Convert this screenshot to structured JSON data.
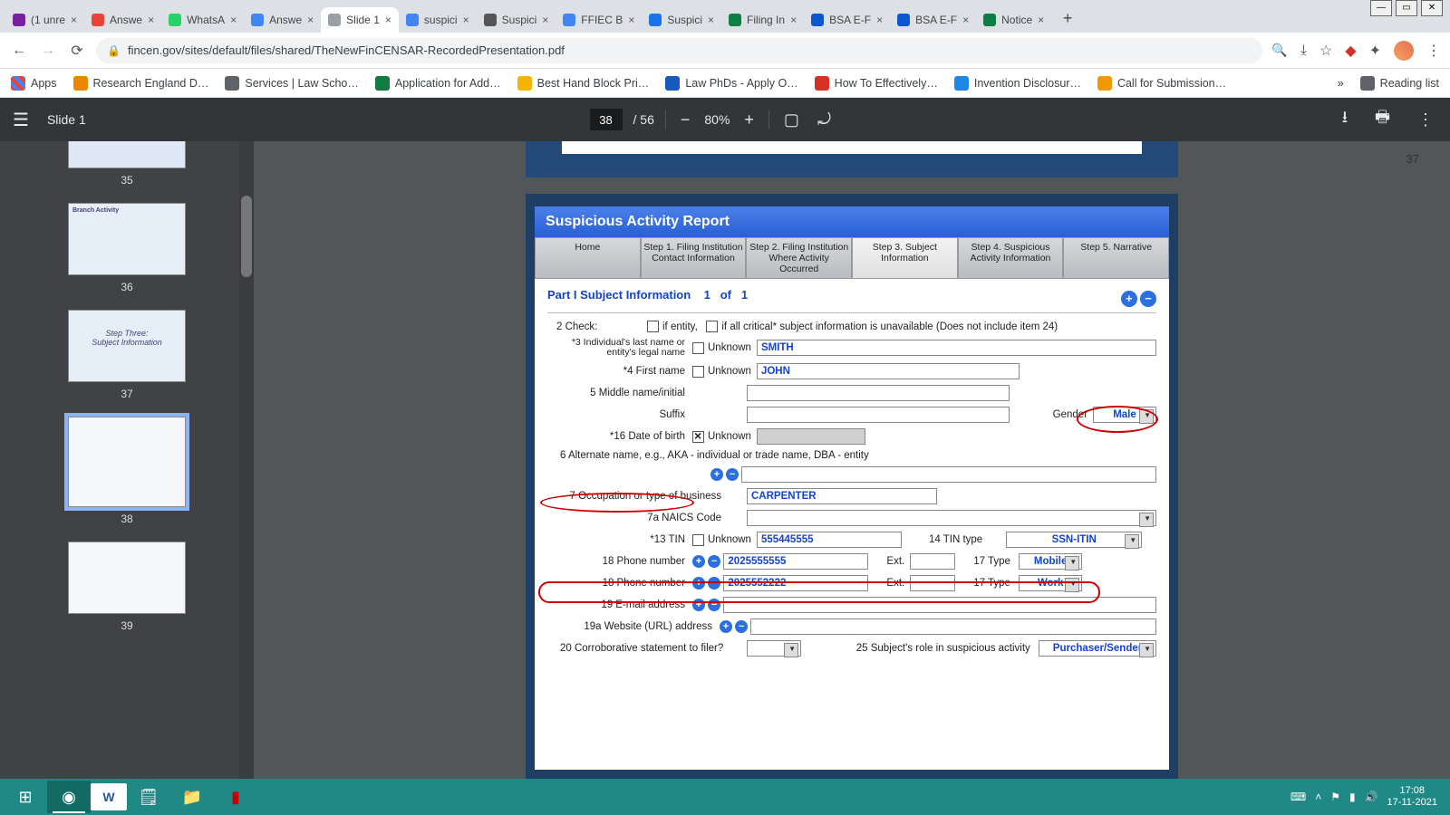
{
  "window_buttons": {
    "min": "—",
    "max": "▭",
    "close": "✕"
  },
  "tabs": [
    {
      "fav": "#7b1fa2",
      "label": "(1 unre"
    },
    {
      "fav": "#ea4335",
      "label": "Answe"
    },
    {
      "fav": "#25d366",
      "label": "WhatsA"
    },
    {
      "fav": "#4285f4",
      "label": "Answe"
    },
    {
      "fav": "#9aa0a6",
      "label": "Slide 1",
      "active": true
    },
    {
      "fav": "#4285f4",
      "label": "suspici"
    },
    {
      "fav": "#555",
      "label": "Suspici"
    },
    {
      "fav": "#4285f4",
      "label": "FFIEC B"
    },
    {
      "fav": "#1a73e8",
      "label": "Suspici"
    },
    {
      "fav": "#0b8043",
      "label": "Filing In"
    },
    {
      "fav": "#0b57d0",
      "label": "BSA E-F"
    },
    {
      "fav": "#0b57d0",
      "label": "BSA E-F"
    },
    {
      "fav": "#0b8043",
      "label": "Notice"
    }
  ],
  "omnibox": {
    "url": "fincen.gov/sites/default/files/shared/TheNewFinCENSAR-RecordedPresentation.pdf"
  },
  "bookmarks": [
    {
      "color": "#ea8600",
      "label": "Research England D…"
    },
    {
      "color": "#5f6368",
      "label": "Services | Law Scho…"
    },
    {
      "color": "#107c41",
      "label": "Application for Add…"
    },
    {
      "color": "#f4b400",
      "label": "Best Hand Block Pri…"
    },
    {
      "color": "#185abc",
      "label": "Law PhDs - Apply O…"
    },
    {
      "color": "#d93025",
      "label": "How To Effectively…"
    },
    {
      "color": "#1e88e5",
      "label": "Invention Disclosur…"
    },
    {
      "color": "#f29900",
      "label": "Call for Submission…"
    }
  ],
  "bookmarks_more": "»",
  "reading_list": "Reading list",
  "apps_label": "Apps",
  "pdfbar": {
    "title": "Slide 1",
    "page": "38",
    "total": "/  56",
    "zoom": "80%"
  },
  "thumbs": [
    "35",
    "36",
    "37",
    "38",
    "39"
  ],
  "prev_page_number": "37",
  "sar": {
    "header": "Suspicious Activity Report",
    "tabs": [
      "Home",
      "Step 1. Filing Institution Contact Information",
      "Step 2. Filing Institution Where Activity Occurred",
      "Step 3. Subject Information",
      "Step 4. Suspicious Activity Information",
      "Step 5. Narrative"
    ],
    "part_title": "Part I Subject Information",
    "pager": {
      "cur": "1",
      "of": "of",
      "tot": "1"
    },
    "row_check": {
      "label": "2 Check:",
      "opt1": "if entity,",
      "opt2": "if all critical* subject information is unavailable (Does not include item 24)"
    },
    "lastname": {
      "label": "*3 Individual's last name or entity's legal name",
      "unk": "Unknown",
      "val": "SMITH"
    },
    "firstname": {
      "label": "*4 First name",
      "unk": "Unknown",
      "val": "JOHN"
    },
    "middle": {
      "label": "5 Middle name/initial"
    },
    "suffix": {
      "label": "Suffix"
    },
    "gender": {
      "label": "Gender",
      "val": "Male"
    },
    "dob": {
      "label": "*16 Date of birth",
      "unk": "Unknown"
    },
    "altname": {
      "label": "6 Alternate name, e.g.,  AKA - individual or trade name, DBA - entity"
    },
    "occ": {
      "label": "7 Occupation or type of business",
      "val": "CARPENTER"
    },
    "naics": {
      "label": "7a NAICS Code"
    },
    "tin": {
      "label": "*13 TIN",
      "unk": "Unknown",
      "val": "555445555"
    },
    "tintype": {
      "label": "14 TIN type",
      "val": "SSN-ITIN"
    },
    "phone1": {
      "label": "18 Phone number",
      "val": "2025555555",
      "ext": "Ext.",
      "type_l": "17 Type",
      "type_v": "Mobile"
    },
    "phone2": {
      "label": "18 Phone number",
      "val": "2025552222",
      "ext": "Ext.",
      "type_l": "17 Type",
      "type_v": "Work"
    },
    "email": {
      "label": "19 E-mail address"
    },
    "url": {
      "label": "19a Website (URL) address"
    },
    "corr": {
      "label": "20 Corroborative statement to filer?"
    },
    "role": {
      "label": "25 Subject's role in suspicious activity",
      "val": "Purchaser/Sender"
    }
  },
  "tray": {
    "time": "17:08",
    "date": "17-11-2021"
  }
}
